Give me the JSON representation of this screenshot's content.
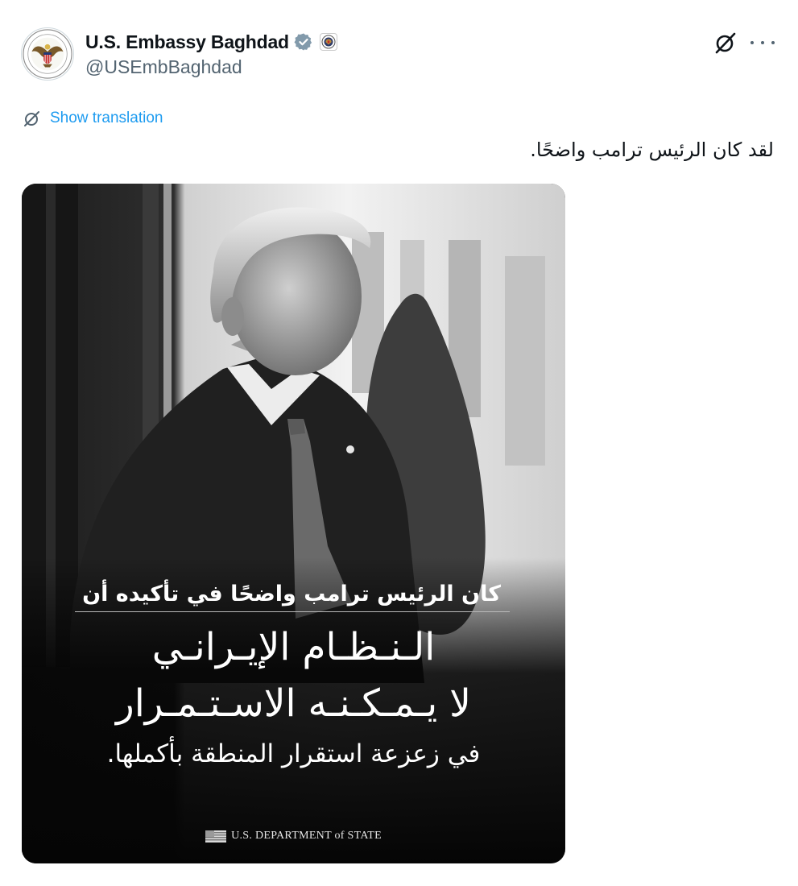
{
  "author": {
    "display_name": "U.S. Embassy Baghdad",
    "handle": "@USEmbBaghdad",
    "verified_badge": "verified-badge-icon",
    "affiliate_badge": "state-department-seal-icon"
  },
  "actions": {
    "grok_icon": "grok-icon",
    "more_icon": "more-icon"
  },
  "translation": {
    "label": "Show translation"
  },
  "tweet": {
    "text": "لقد كان الرئيس ترامب واضحًا."
  },
  "media": {
    "caption_line1": "كان الرئيس ترامب واضحًا في تأكيده أن",
    "caption_line2": "الـنـظـام الإيـرانـي",
    "caption_line3": "لا يـمـكـنـه الاسـتـمـرار",
    "caption_line4": "في زعزعة استقرار المنطقة بأكملها.",
    "footer_label": "U.S. DEPARTMENT of STATE",
    "footer_flag": "us-flag-icon"
  },
  "colors": {
    "link": "#1d9bf0",
    "secondary_text": "#536471",
    "verified": "#829aab"
  }
}
